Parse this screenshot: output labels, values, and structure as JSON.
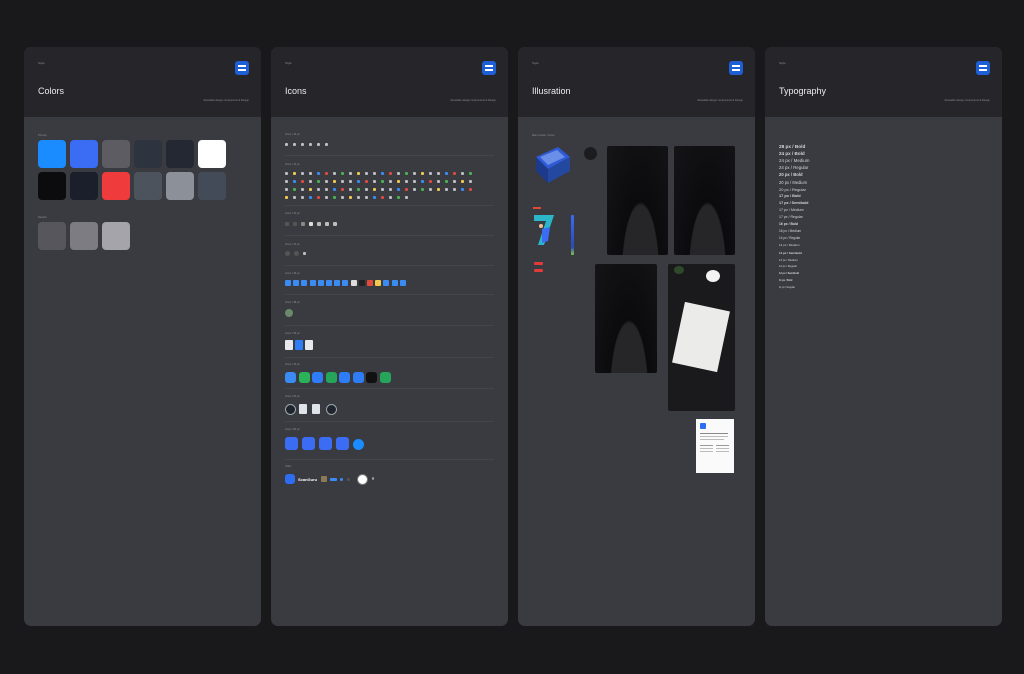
{
  "panels": {
    "colors": {
      "caption": "Style",
      "title": "Colors",
      "subtitle": "Reusable design components & Design",
      "primary_label": "Primary",
      "neutral_label": "Neutral",
      "primary_colors": [
        "#1a8cff",
        "#3a6cf4",
        "#5c5c62",
        "#2e3340",
        "#232833",
        "#ffffff",
        "#0c0c0e",
        "#1a1f2b",
        "#ef3b3b",
        "#4d535c",
        "#8c9099",
        "#434b58"
      ],
      "neutral_colors": [
        "#56565c",
        "#7c7c82",
        "#a4a4aa"
      ]
    },
    "icons": {
      "caption": "Style",
      "title": "Icons",
      "subtitle": "Reusable design components & Design",
      "sections": [
        "Icons / 16 px",
        "Icons / 12 px",
        "Icons / 20 px",
        "Icons / 24 px",
        "Icons / 36 px",
        "Icons / 48 px",
        "Icons / 56 px",
        "Icons / 40 px",
        "Icons / 60 px",
        "Icons / 80 px",
        "Other"
      ],
      "brand_name": "ScanGuru"
    },
    "illustration": {
      "caption": "Style",
      "title": "Illusration",
      "subtitle": "Reusable design components & Design",
      "section_label": "Main screen / Icons"
    },
    "typography": {
      "caption": "Style",
      "title": "Typography",
      "subtitle": "Reusable design components & Design",
      "styles": [
        "28 px / Bold",
        "24 px / Bold",
        "24 px / Medium",
        "24 px / Regular",
        "20 px / Bold",
        "20 px / Medium",
        "20 px / Regular",
        "17 px / Bold",
        "17 px / Semibold",
        "17 px / Medium",
        "17 px / Regular",
        "16 px / Bold",
        "16 px / Medium",
        "14 px / Regular",
        "14 px / Medium",
        "14 px / Semibold",
        "13 px / Medium",
        "12 px / Regular",
        "12 px / Semibold",
        "11 px / Bold",
        "11 px / Regular"
      ]
    }
  }
}
